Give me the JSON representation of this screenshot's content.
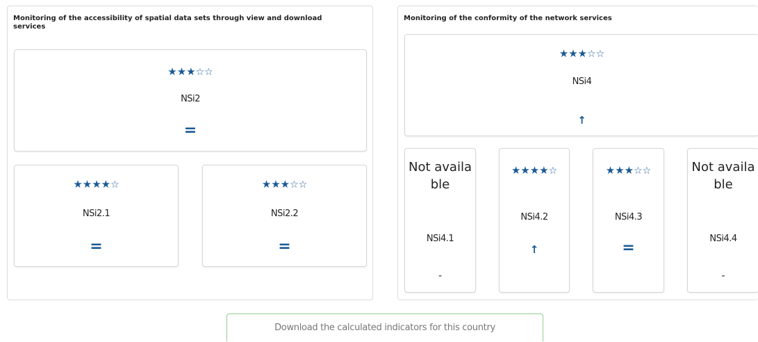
{
  "left_panel": {
    "title": "Monitoring of the accessibility of spatial data sets through view and download services",
    "main": {
      "stars_filled": "★★★",
      "stars_empty": "☆☆",
      "rating": 3,
      "label": "NSi2",
      "trend": "="
    },
    "subs": [
      {
        "stars_filled": "★★★★",
        "stars_empty": "☆",
        "rating": 4,
        "label": "NSi2.1",
        "trend": "="
      },
      {
        "stars_filled": "★★★",
        "stars_empty": "☆☆",
        "rating": 3,
        "label": "NSi2.2",
        "trend": "="
      }
    ]
  },
  "right_panel": {
    "title": "Monitoring of the conformity of the network services",
    "main": {
      "stars_filled": "★★★",
      "stars_empty": "☆☆",
      "rating": 3,
      "label": "NSi4",
      "trend": "↑"
    },
    "subs": [
      {
        "status": "Not available",
        "label": "NSi4.1",
        "trend": "-"
      },
      {
        "stars_filled": "★★★★",
        "stars_empty": "☆",
        "rating": 4,
        "label": "NSi4.2",
        "trend": "↑"
      },
      {
        "stars_filled": "★★★",
        "stars_empty": "☆☆",
        "rating": 3,
        "label": "NSi4.3",
        "trend": "="
      },
      {
        "status": "Not available",
        "label": "NSi4.4",
        "trend": "-"
      }
    ]
  },
  "download": {
    "label": "Download the calculated indicators for this country"
  },
  "colors": {
    "accent": "#1a5a96",
    "button_border": "#8fcf8f",
    "panel_border": "#dcdcdc"
  }
}
